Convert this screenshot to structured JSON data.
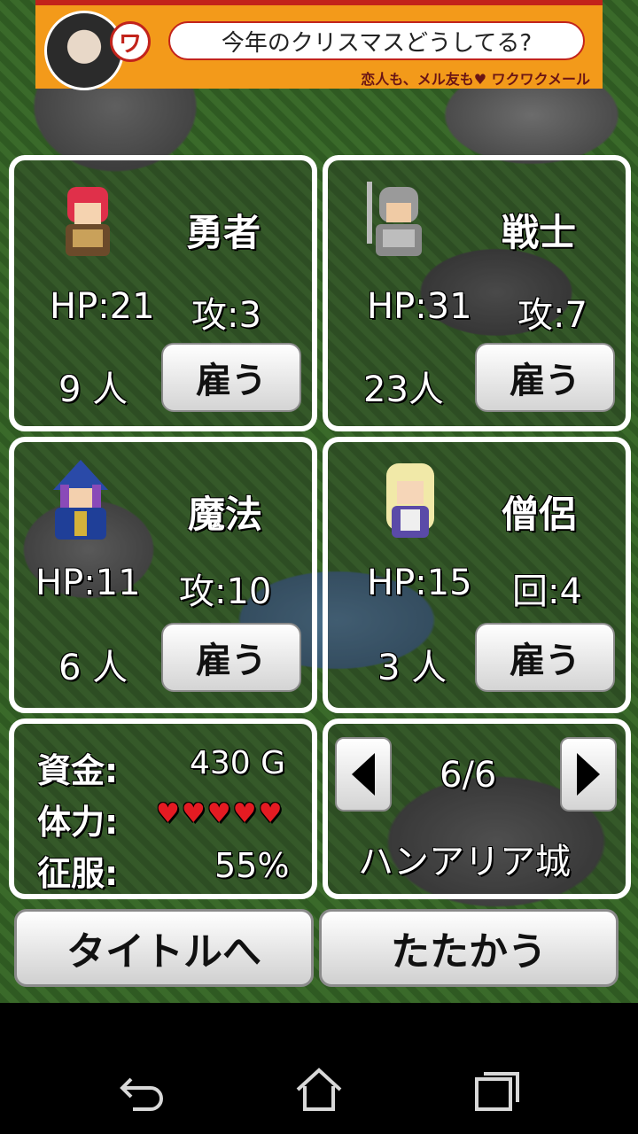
{
  "ad": {
    "headline": "今年のクリスマスどうしてる?",
    "logo_glyph": "ワ",
    "subline": "恋人も、メル友も♥ ワクワクメール"
  },
  "characters": [
    {
      "name": "勇者",
      "hp": "HP:21",
      "stat": "攻:3",
      "count": "9 人",
      "button": "雇う",
      "sprite": "hero-sprite"
    },
    {
      "name": "戦士",
      "hp": "HP:31",
      "stat": "攻:7",
      "count": "23人",
      "button": "雇う",
      "sprite": "warrior-sprite"
    },
    {
      "name": "魔法",
      "hp": "HP:11",
      "stat": "攻:10",
      "count": "6 人",
      "button": "雇う",
      "sprite": "mage-sprite"
    },
    {
      "name": "僧侶",
      "hp": "HP:15",
      "stat": "回:4",
      "count": "3 人",
      "button": "雇う",
      "sprite": "priest-sprite"
    }
  ],
  "status": {
    "funds_label": "資金:",
    "funds_value": "430 G",
    "stamina_label": "体力:",
    "stamina_hearts": "♥♥♥♥♥",
    "conquest_label": "征服:",
    "conquest_value": "55%"
  },
  "stage": {
    "page": "6/6",
    "location": "ハンアリア城"
  },
  "buttons": {
    "title": "タイトルへ",
    "fight": "たたかう"
  },
  "colors": {
    "heart": "#e41b22",
    "ad_bg": "#f39a1a"
  }
}
